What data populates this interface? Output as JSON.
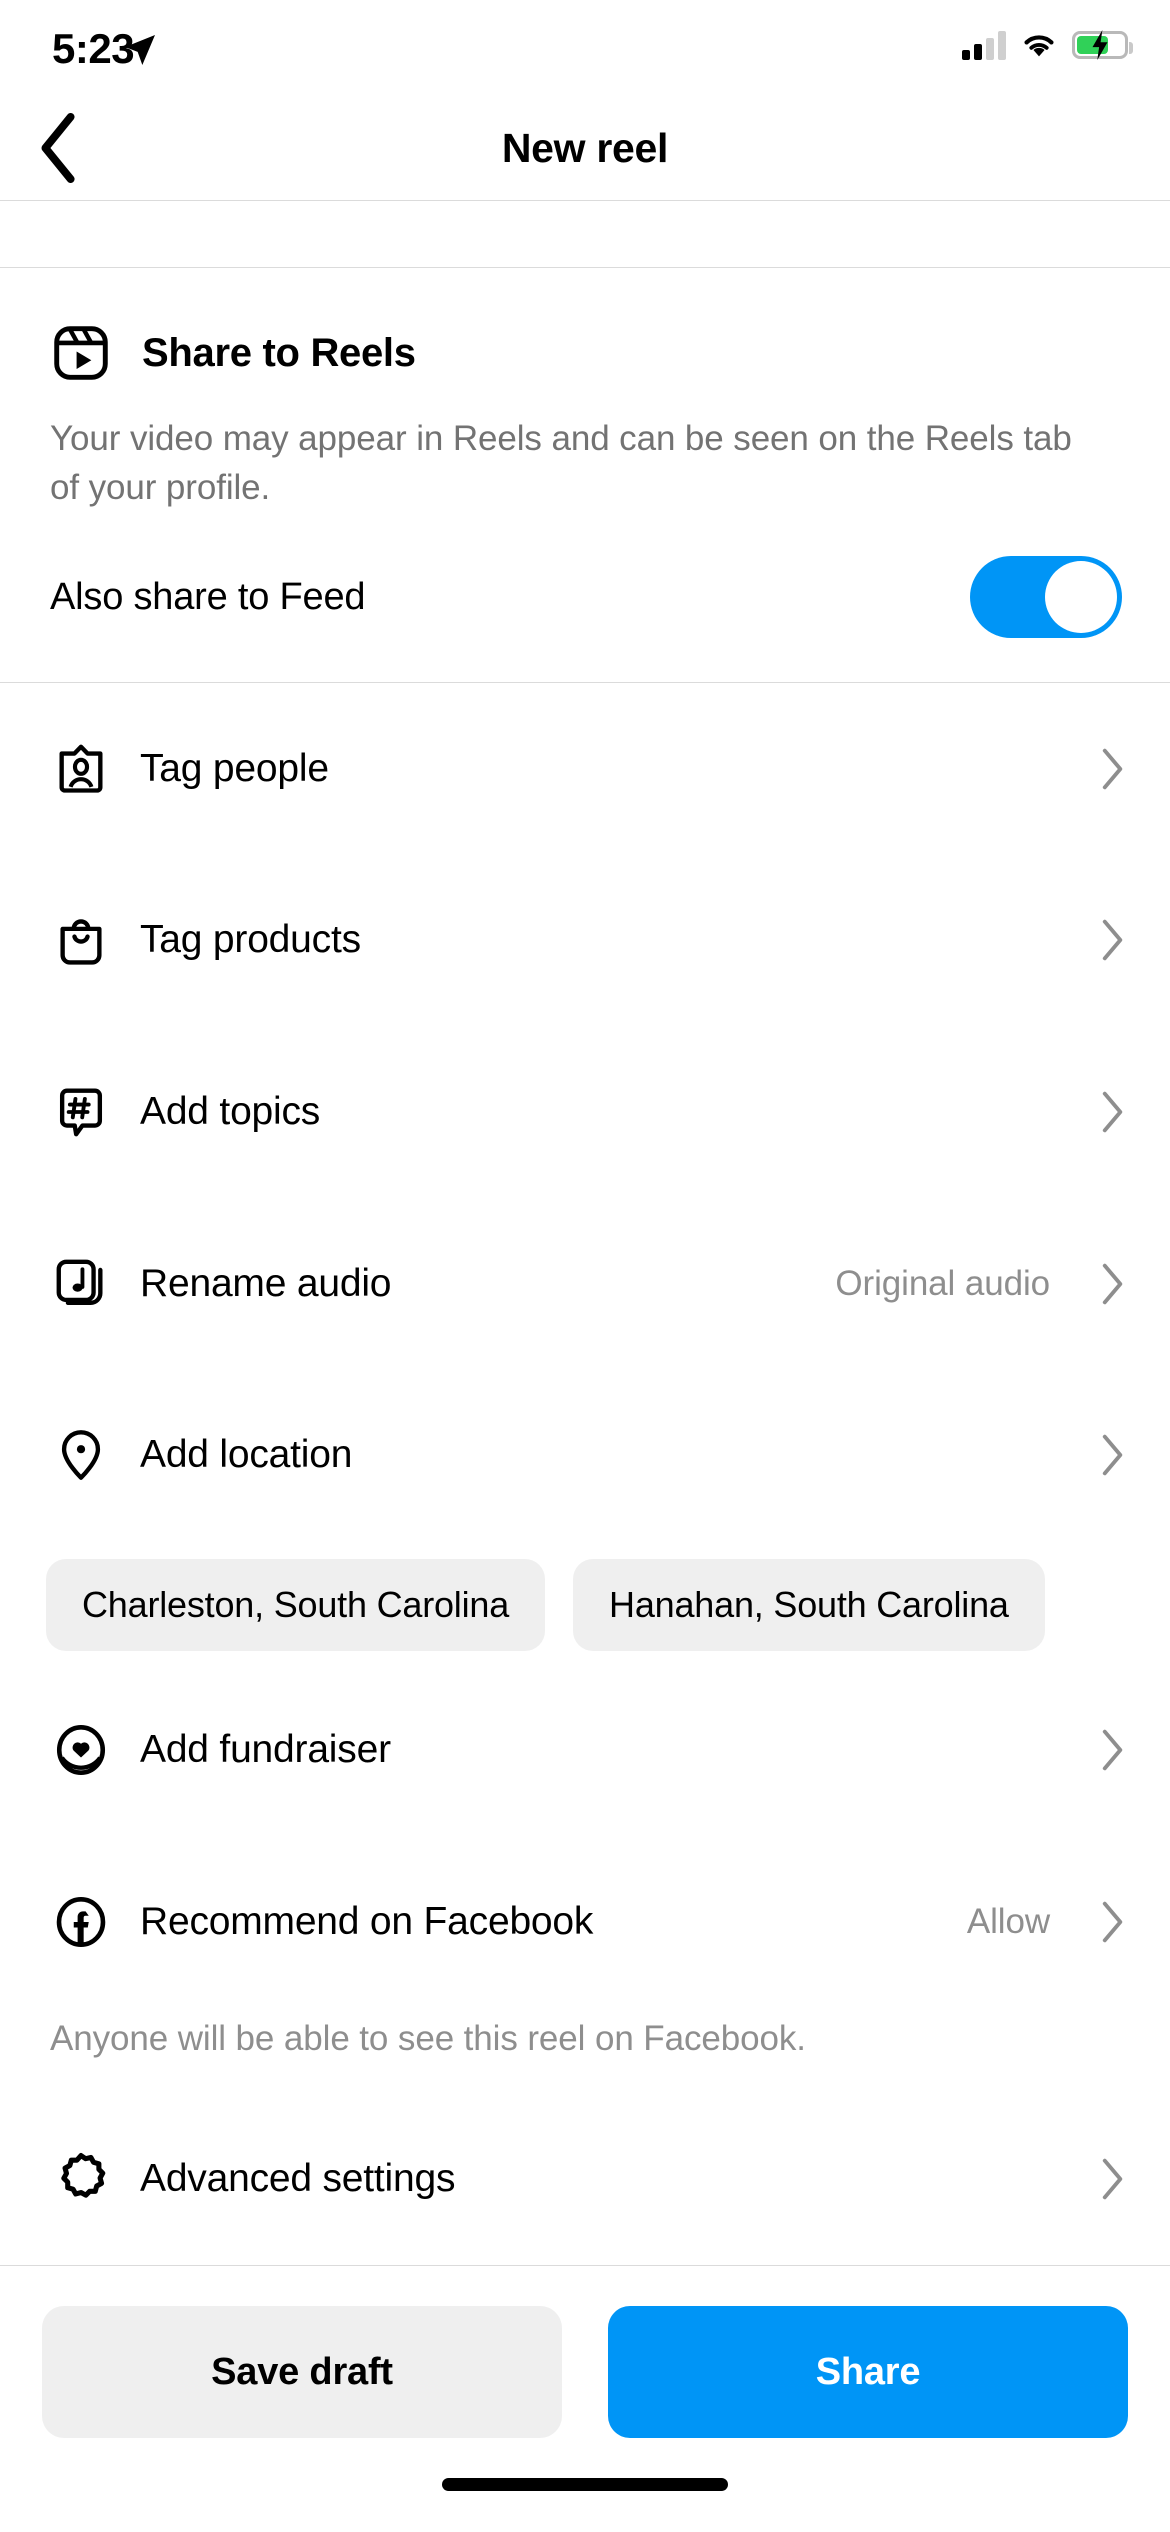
{
  "status_bar": {
    "time": "5:23",
    "location_icon": "location-arrow-icon",
    "signal_icon": "cellular-signal-icon",
    "signal_bars_filled": 2,
    "signal_bars_total": 4,
    "wifi_icon": "wifi-icon",
    "battery_icon": "battery-charging-icon",
    "battery_color": "#30d158"
  },
  "nav": {
    "back_icon": "chevron-left-icon",
    "title": "New reel"
  },
  "reels": {
    "icon": "reels-clapperboard-icon",
    "title": "Share to Reels",
    "description": "Your video may appear in Reels and can be seen on the Reels tab of your profile.",
    "feed_toggle_label": "Also share to Feed",
    "feed_toggle_on": true,
    "toggle_color": "#0095f6"
  },
  "options": [
    {
      "icon": "tag-people-icon",
      "label": "Tag people",
      "value": "",
      "chevron": "chevron-right-icon"
    },
    {
      "icon": "shopping-bag-icon",
      "label": "Tag products",
      "value": "",
      "chevron": "chevron-right-icon"
    },
    {
      "icon": "hashtag-bubble-icon",
      "label": "Add topics",
      "value": "",
      "chevron": "chevron-right-icon"
    },
    {
      "icon": "music-note-card-icon",
      "label": "Rename audio",
      "value": "Original audio",
      "chevron": "chevron-right-icon"
    },
    {
      "icon": "location-pin-icon",
      "label": "Add location",
      "value": "",
      "chevron": "chevron-right-icon"
    }
  ],
  "location_suggestions": [
    "Charleston, South Carolina",
    "Hanahan, South Carolina"
  ],
  "fundraiser": {
    "icon": "heart-circle-icon",
    "label": "Add fundraiser",
    "chevron": "chevron-right-icon"
  },
  "facebook": {
    "icon": "facebook-icon",
    "label": "Recommend on Facebook",
    "value": "Allow",
    "chevron": "chevron-right-icon",
    "note": "Anyone will be able to see this reel on Facebook."
  },
  "advanced": {
    "icon": "gear-icon",
    "label": "Advanced settings",
    "chevron": "chevron-right-icon"
  },
  "actions": {
    "save_draft_label": "Save draft",
    "share_label": "Share",
    "primary_color": "#0095f6",
    "secondary_color": "#efefef"
  },
  "home_indicator": "home-indicator"
}
